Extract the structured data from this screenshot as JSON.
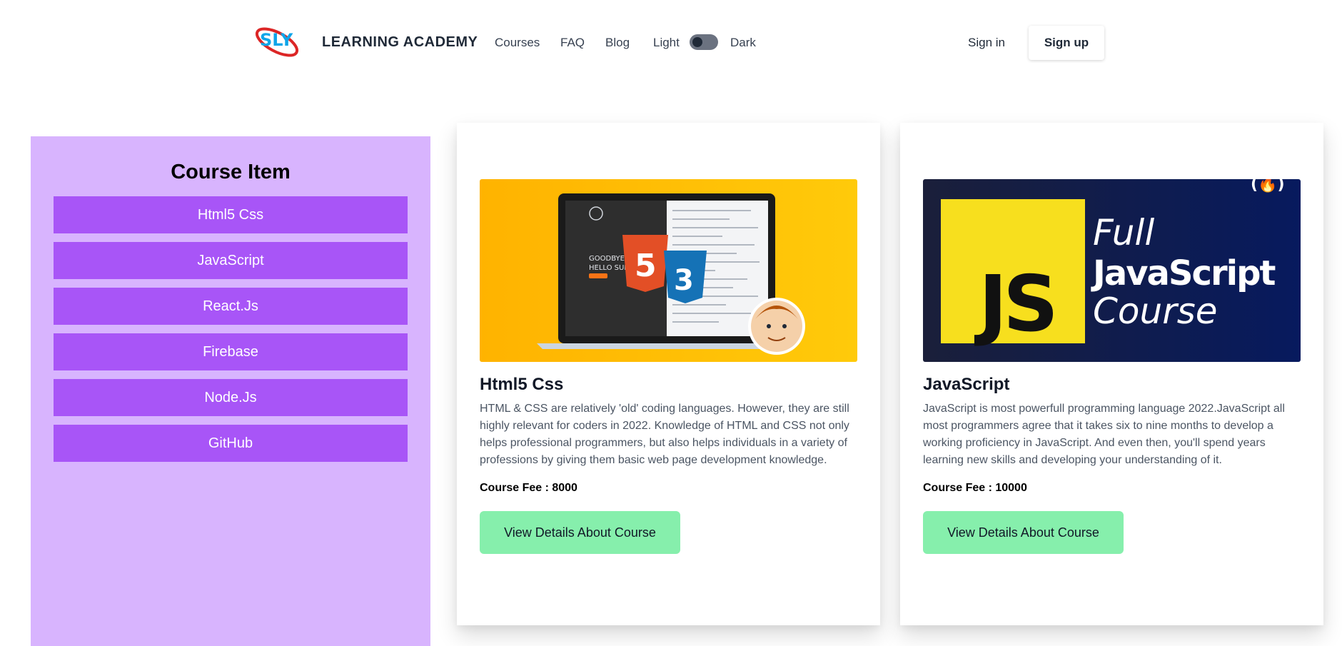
{
  "header": {
    "logo_text": "SLY",
    "brand": "LEARNING ACADEMY",
    "nav": [
      "Courses",
      "FAQ",
      "Blog"
    ],
    "theme": {
      "light_label": "Light",
      "dark_label": "Dark"
    },
    "signin_label": "Sign in",
    "signup_label": "Sign up"
  },
  "sidebar": {
    "title": "Course Item",
    "items": [
      "Html5 Css",
      "JavaScript",
      "React.Js",
      "Firebase",
      "Node.Js",
      "GitHub"
    ]
  },
  "courses": [
    {
      "title": "Html5 Css",
      "description": "HTML & CSS are relatively 'old' coding languages. However, they are still highly relevant for coders in 2022. Knowledge of HTML and CSS not only helps professional programmers, but also helps individuals in a variety of professions by giving them basic web page development knowledge.",
      "fee": "Course Fee : 8000",
      "button": "View Details About Course",
      "image": {
        "screen_text_1": "GOODBYE",
        "screen_text_2": "HELLO SUP",
        "badge_1": "5",
        "badge_2": "3"
      }
    },
    {
      "title": "JavaScript",
      "description": "JavaScript is most powerfull programming language 2022.JavaScript all most programmers agree that it takes six to nine months to develop a working proficiency in JavaScript. And even then, you'll spend years learning new skills and developing your understanding of it.",
      "fee": "Course Fee : 10000",
      "button": "View Details About Course",
      "image": {
        "js": "JS",
        "line1": "Full",
        "line2": "JavaScript",
        "line3": "Course",
        "corner": "(🔥)"
      }
    }
  ],
  "colors": {
    "sidebar_bg": "#d8b4fe",
    "sidebar_item": "#a855f7",
    "button_green": "#86efac",
    "js_yellow": "#f7df1e",
    "navy": "#0b1654"
  }
}
